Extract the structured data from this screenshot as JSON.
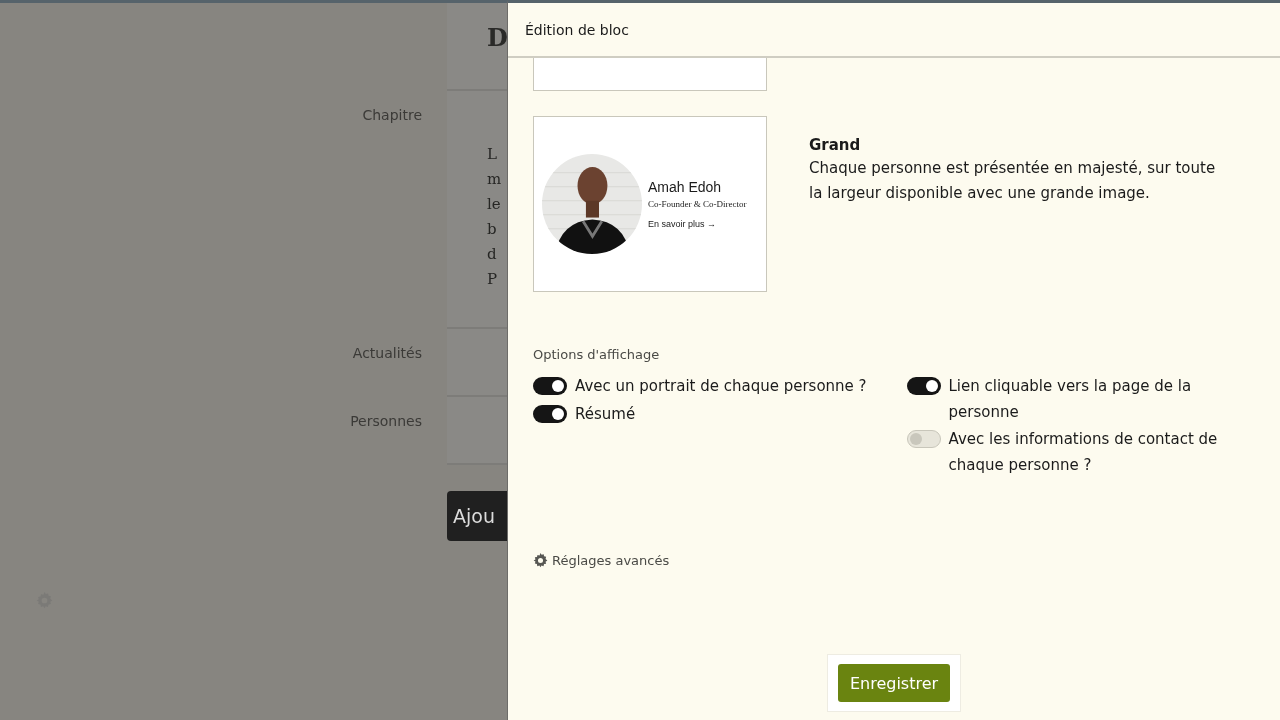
{
  "background_page": {
    "heading": "D",
    "sections": [
      {
        "label": "Chapitre",
        "text_lines": [
          "L",
          "m",
          "le",
          "b",
          "d",
          "P"
        ]
      },
      {
        "label": "Actualités"
      },
      {
        "label": "Personnes"
      }
    ],
    "add_button": "Ajou"
  },
  "drawer": {
    "title": "Édition de bloc",
    "layout_options": [
      {
        "kind": "blank"
      },
      {
        "kind": "preview",
        "preview": {
          "name": "Amah Edoh",
          "role": "Co-Founder & Co-Director",
          "link": "En savoir plus →"
        },
        "title": "Grand",
        "description": "Chaque personne est présentée en majesté, sur toute la largeur disponible avec une grande image."
      }
    ],
    "options_title": "Options d'affichage",
    "toggle_columns": [
      [
        {
          "label": "Avec un portrait de chaque personne ?",
          "on": true
        },
        {
          "label": "Résumé",
          "on": true
        }
      ],
      [
        {
          "label": "Lien cliquable vers la page de la personne",
          "on": true
        },
        {
          "label": "Avec les informations de contact de chaque personne ?",
          "on": false
        }
      ]
    ],
    "advanced": "Réglages avancés",
    "save_button": "Enregistrer"
  }
}
